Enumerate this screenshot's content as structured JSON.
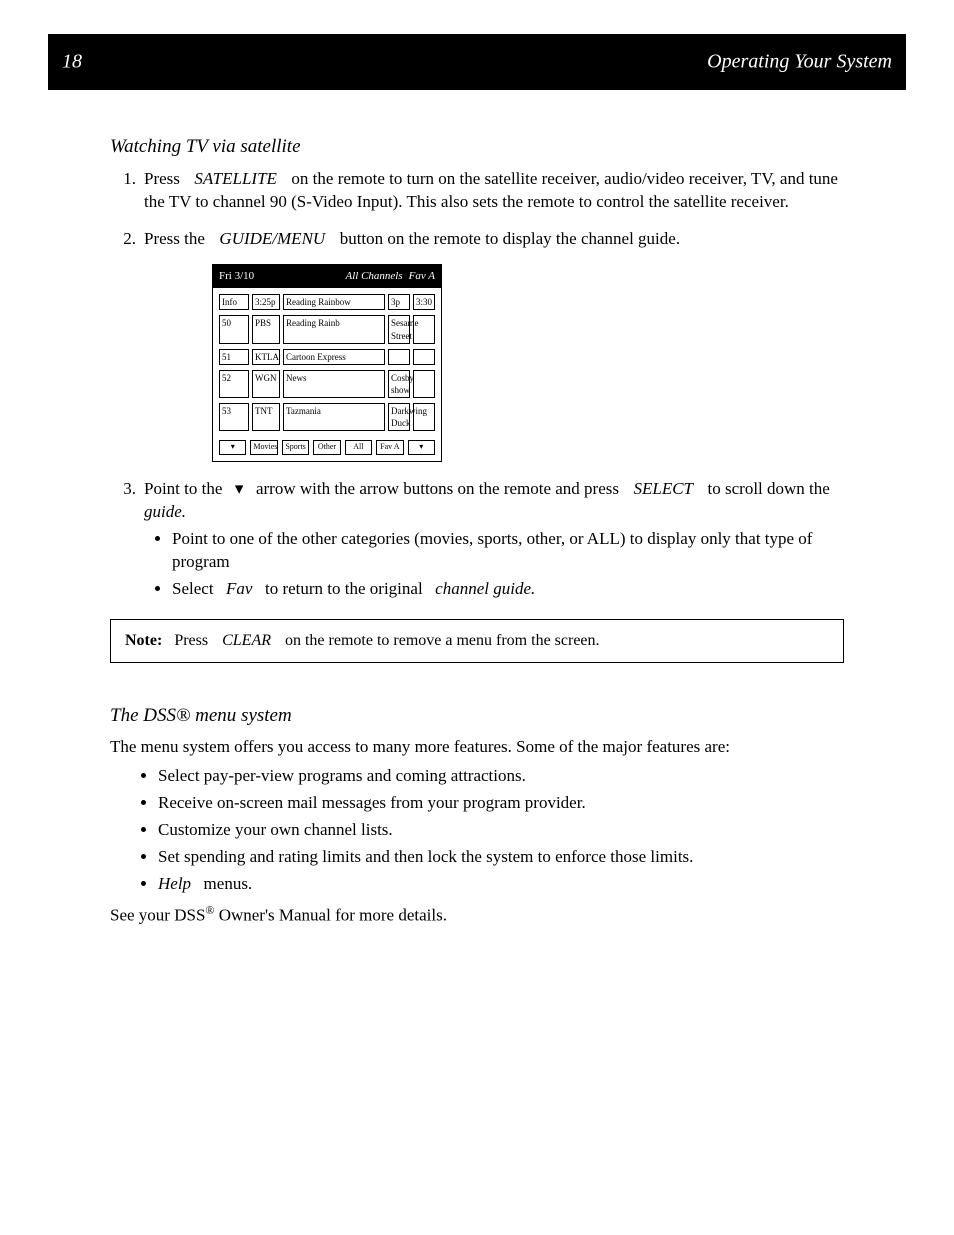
{
  "banner": {
    "page_num": "18",
    "title": "Operating Your System"
  },
  "section1": {
    "heading": "Watching TV via satellite",
    "step1": {
      "num": "1.",
      "t1": "Press",
      "btn": "SATELLITE",
      "t2": "on the remote to turn on the satellite receiver, audio/video receiver, TV, and tune the TV to channel 90 (S-Video Input).  This also sets the remote to control the satellite receiver."
    },
    "step2": {
      "num": "2.",
      "t1": "Press the",
      "btn": "GUIDE/MENU",
      "t2": "button on the remote to display the channel guide."
    },
    "guide": {
      "head_a": "Fri 3/10",
      "head_b": "All Channels",
      "head_c": "Fav A",
      "rows": [
        {
          "c1": "Info",
          "c2": "3:25p",
          "c3": "Reading Rainbow",
          "c4": "3p",
          "c5": "3:30"
        },
        {
          "c1": "50  ",
          "c2": "PBS",
          "c3": "Reading Rainb",
          "c4": "Sesame Street",
          "c5": ""
        },
        {
          "c1": "51  ",
          "c2": "KTLA",
          "c3": "Cartoon Express",
          "c4": "",
          "c5": ""
        },
        {
          "c1": "52  ",
          "c2": "WGN",
          "c3": "News",
          "c4": "Cosby show",
          "c5": ""
        },
        {
          "c1": "53  ",
          "c2": "TNT",
          "c3": "Tazmania",
          "c4": "Darkwing Duck",
          "c5": ""
        }
      ],
      "foot": [
        "▾",
        "Movies",
        "Sports",
        "Other",
        "All",
        "Fav A",
        "▾"
      ]
    },
    "step3": {
      "num": "3.",
      "t1": "Point to the",
      "arrow": "▾",
      "t2": "arrow with the arrow buttons on the remote and press",
      "btn": "SELECT",
      "t3": "to scroll down the",
      "t4": "guide.",
      "sub1a": "Point to one of the other categories (movies, sports, other, or ALL) to display only that type of program",
      "sub2a": "Select",
      "sub2b": "Fav",
      "sub2c": "to return to the original",
      "sub2d": "channel guide."
    },
    "note": {
      "label": "Note:",
      "t1": "Press",
      "btn": "CLEAR",
      "t2": "on the remote to remove a menu from the screen."
    }
  },
  "section2": {
    "heading": "The DSS® menu system",
    "intro": "The menu system offers you access to many more features.  Some of the major features are:",
    "features": [
      "Select pay-per-view programs and coming attractions.",
      "Receive on-screen mail messages from your program provider.",
      "Customize your own channel lists.",
      "Set spending and rating limits and then lock the system to enforce those limits."
    ],
    "feat5a": "Help",
    "feat5b": "menus.",
    "see_a": "See your DSS",
    "see_b": " Owner's Manual for more details."
  }
}
